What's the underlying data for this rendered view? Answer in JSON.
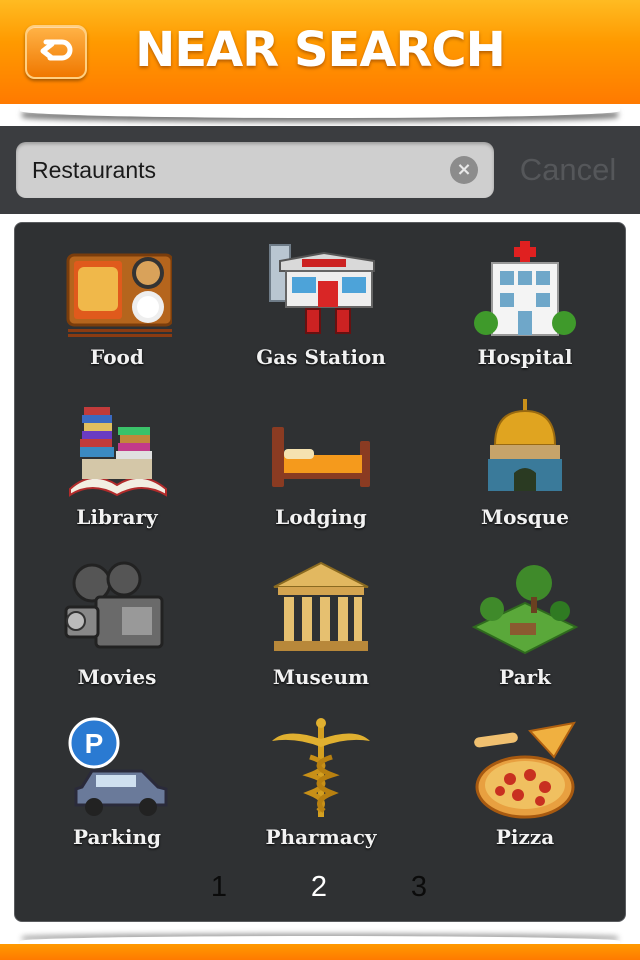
{
  "header": {
    "title": "NEAR SEARCH",
    "back_icon": "back-arrow-icon",
    "accent_color": "#ff8a00"
  },
  "search": {
    "value": "Restaurants",
    "clear_icon": "clear-icon",
    "cancel_label": "Cancel"
  },
  "categories": [
    {
      "label": "Food",
      "icon": "food-tray-icon"
    },
    {
      "label": "Gas Station",
      "icon": "gas-station-icon"
    },
    {
      "label": "Hospital",
      "icon": "hospital-icon"
    },
    {
      "label": "Library",
      "icon": "books-icon"
    },
    {
      "label": "Lodging",
      "icon": "bed-icon"
    },
    {
      "label": "Mosque",
      "icon": "mosque-icon"
    },
    {
      "label": "Movies",
      "icon": "movie-camera-icon"
    },
    {
      "label": "Museum",
      "icon": "museum-icon"
    },
    {
      "label": "Park",
      "icon": "park-icon"
    },
    {
      "label": "Parking",
      "icon": "parking-car-icon"
    },
    {
      "label": "Pharmacy",
      "icon": "caduceus-icon"
    },
    {
      "label": "Pizza",
      "icon": "pizza-icon"
    }
  ],
  "pager": {
    "pages": [
      "1",
      "2",
      "3"
    ],
    "current": "2"
  }
}
